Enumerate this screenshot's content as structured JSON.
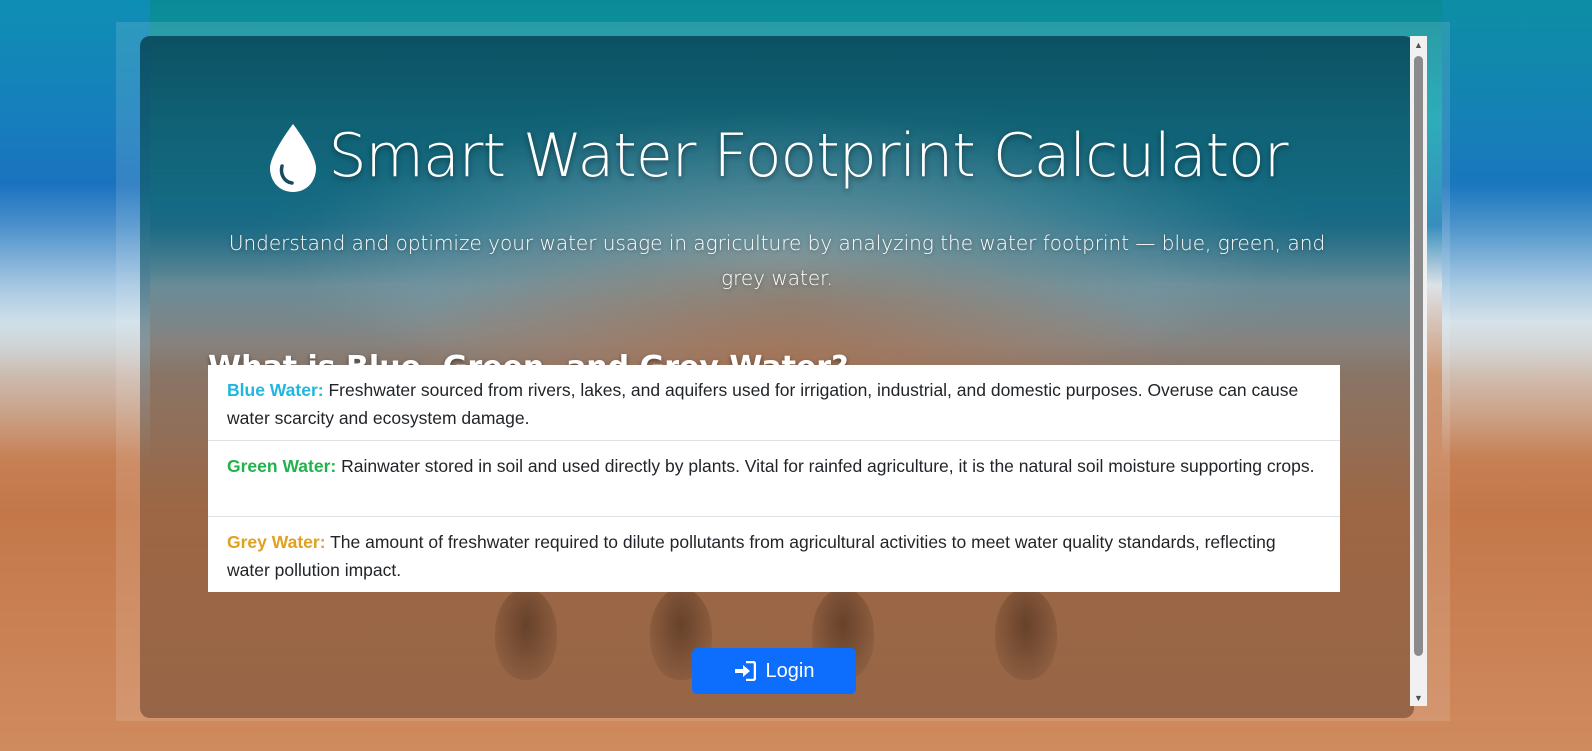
{
  "header": {
    "title": "Smart Water Footprint Calculator",
    "subtitle": "Understand and optimize your water usage in agriculture by analyzing the water footprint — blue, green, and grey water.",
    "icon": "water-drop-icon"
  },
  "section": {
    "heading": "What is Blue, Green, and Grey Water?",
    "items": [
      {
        "term": "Blue Water:",
        "description": "Freshwater sourced from rivers, lakes, and aquifers used for irrigation, industrial, and domestic purposes. Overuse can cause water scarcity and ecosystem damage.",
        "color": "#1fb7e0"
      },
      {
        "term": "Green Water:",
        "description": "Rainwater stored in soil and used directly by plants. Vital for rainfed agriculture, it is the natural soil moisture supporting crops.",
        "color": "#22b24c"
      },
      {
        "term": "Grey Water:",
        "description": "The amount of freshwater required to dilute pollutants from agricultural activities to meet water quality standards, reflecting water pollution impact.",
        "color": "#e0a020"
      }
    ]
  },
  "actions": {
    "login_label": "Login",
    "login_icon": "sign-in-icon",
    "login_color": "#0d6efd"
  }
}
